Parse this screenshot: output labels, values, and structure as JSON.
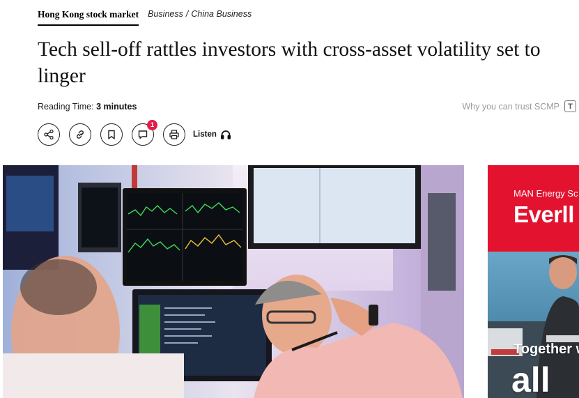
{
  "topic": {
    "label": "Hong Kong stock market"
  },
  "breadcrumb": {
    "section": "Business",
    "separator": "/",
    "subsection": "China Business"
  },
  "headline": "Tech sell-off rattles investors with cross-asset volatility set to linger",
  "reading_time": {
    "label": "Reading Time:",
    "value": "3 minutes"
  },
  "trust": {
    "label": "Why you can trust SCMP",
    "icon": "trust-badge-icon"
  },
  "actions": {
    "share_icon": "share-icon",
    "link_icon": "link-icon",
    "bookmark_icon": "bookmark-icon",
    "comment_icon": "comment-icon",
    "comment_count": "1",
    "print_icon": "print-icon",
    "listen_label": "Listen",
    "listen_icon": "headphones-icon"
  },
  "hero_image": {
    "subject": "trader-at-screens-photo"
  },
  "ad": {
    "brand": "MAN Energy Sc",
    "headline_word": "Everll",
    "tagline": "Together w",
    "big_word": "all"
  },
  "colors": {
    "badge": "#e11d48",
    "ad_red": "#e3122f",
    "muted": "#9a9a9a"
  }
}
